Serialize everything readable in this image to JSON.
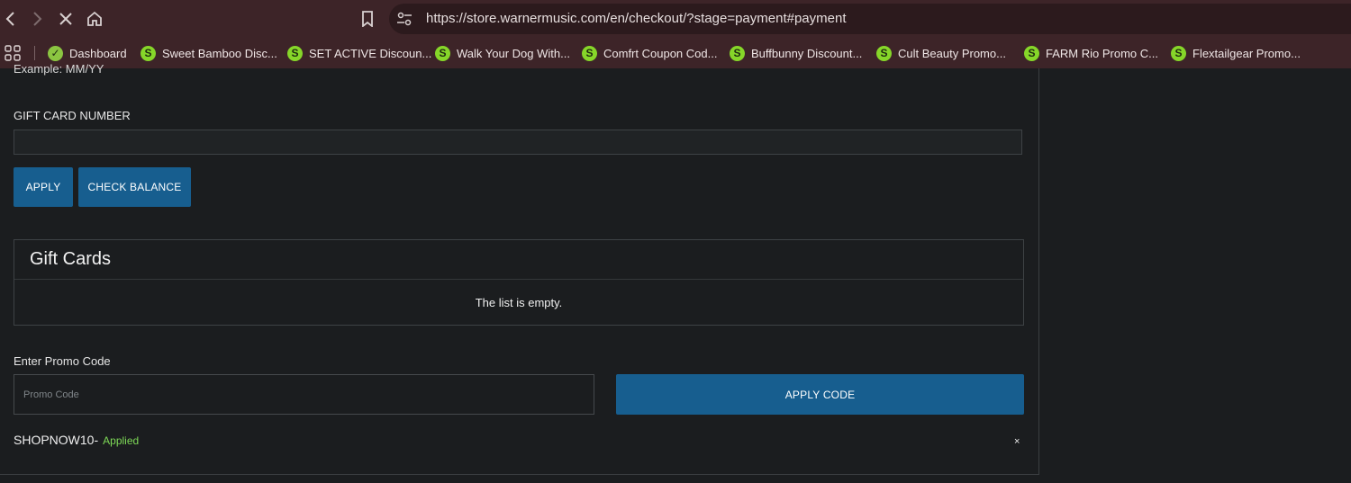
{
  "browser": {
    "url": "https://store.warnermusic.com/en/checkout/?stage=payment#payment",
    "bookmarks": [
      {
        "label": "Dashboard",
        "icon": "dashboard-favicon-icon"
      },
      {
        "label": "Sweet Bamboo Disc...",
        "icon": "s-favicon-icon"
      },
      {
        "label": "SET ACTIVE Discoun...",
        "icon": "s-favicon-icon"
      },
      {
        "label": "Walk Your Dog With...",
        "icon": "s-favicon-icon"
      },
      {
        "label": "Comfrt Coupon Cod...",
        "icon": "s-favicon-icon"
      },
      {
        "label": "Buffbunny Discount...",
        "icon": "s-favicon-icon"
      },
      {
        "label": "Cult Beauty Promo...",
        "icon": "s-favicon-icon"
      },
      {
        "label": "FARM Rio Promo C...",
        "icon": "s-favicon-icon"
      },
      {
        "label": "Flextailgear Promo...",
        "icon": "s-favicon-icon"
      }
    ],
    "favicon_letter": "S"
  },
  "payment": {
    "clipped_hint": "Example: MM/YY",
    "gift_card_label": "GIFT CARD NUMBER",
    "gift_card_value": "",
    "apply_label": "APPLY",
    "check_balance_label": "CHECK BALANCE",
    "gift_cards_title": "Gift Cards",
    "gift_cards_empty": "The list is empty.",
    "promo_label": "Enter Promo Code",
    "promo_placeholder": "Promo Code",
    "apply_code_label": "APPLY CODE",
    "applied_code": "SHOPNOW10",
    "applied_separator": " -",
    "applied_status": "Applied",
    "remove_symbol": "×"
  },
  "colors": {
    "chrome": "#3d2428",
    "page_bg": "#1b1d1f",
    "button": "#175e8f",
    "applied_text": "#7ed957"
  }
}
